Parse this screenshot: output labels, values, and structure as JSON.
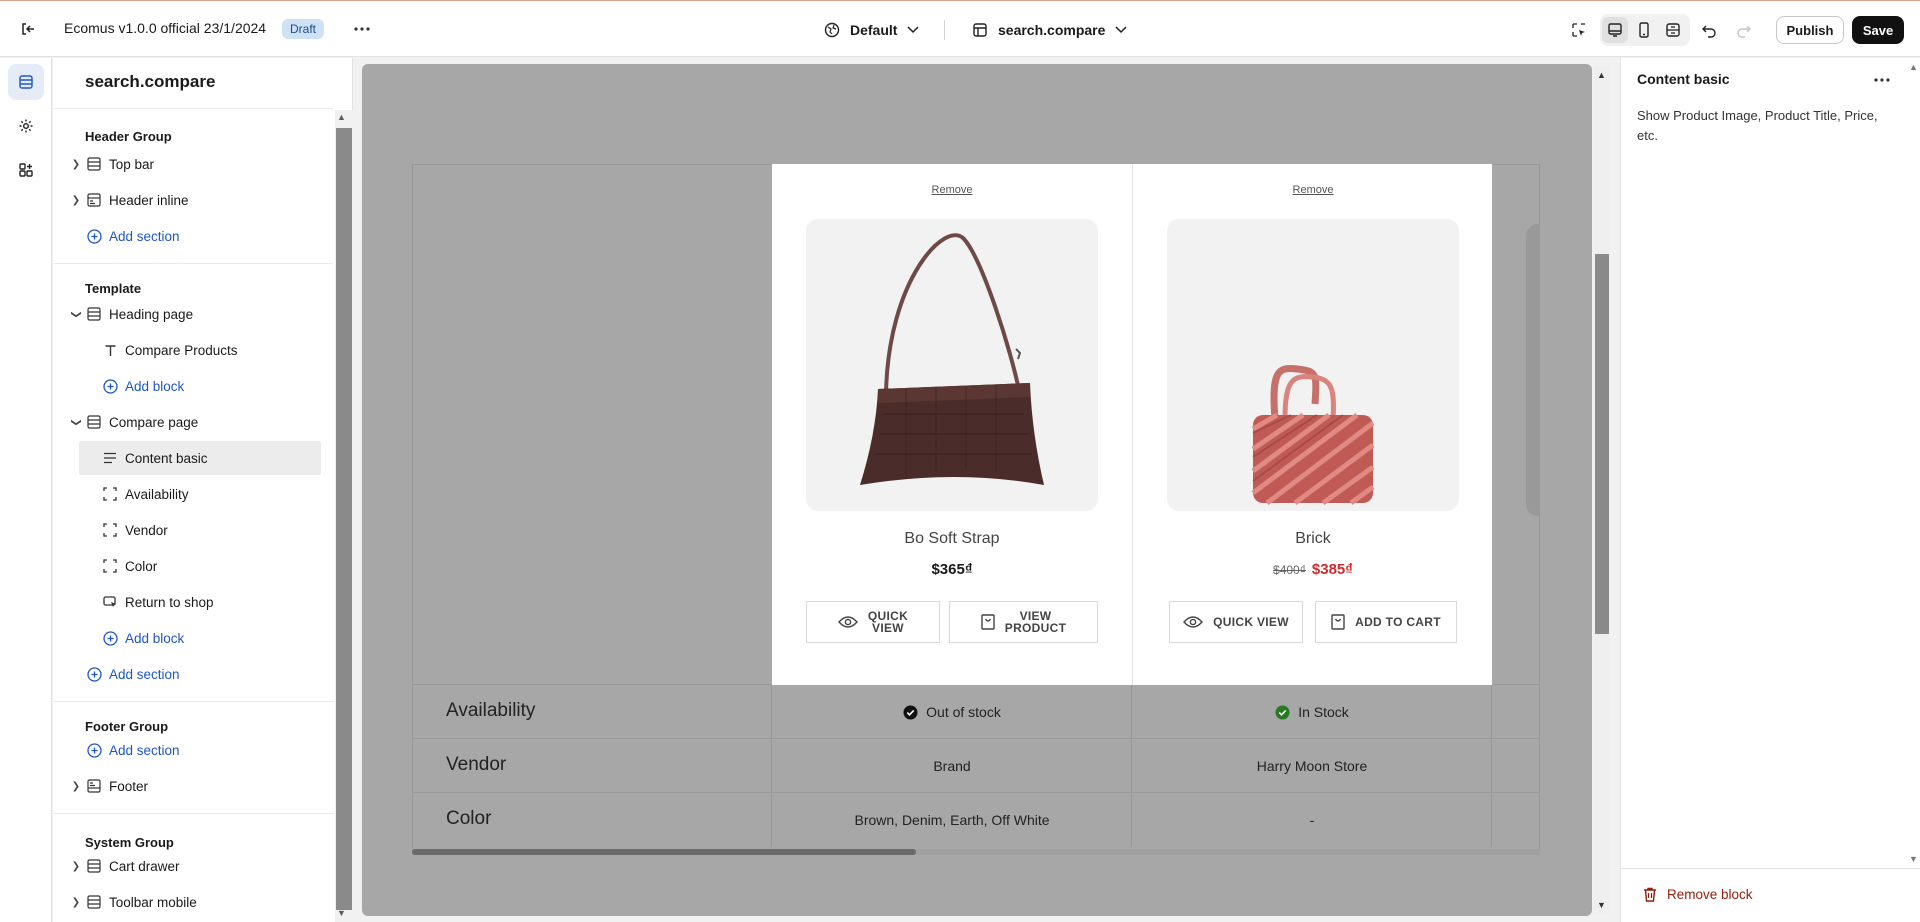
{
  "topbar": {
    "title": "Ecomus v1.0.0 official 23/1/2024",
    "badge": "Draft",
    "theme_label": "Default",
    "page_label": "search.compare",
    "publish_label": "Publish",
    "save_label": "Save"
  },
  "sidebar": {
    "title": "search.compare",
    "header_group": {
      "heading": "Header Group",
      "items": [
        "Top bar",
        "Header inline"
      ],
      "add_section": "Add section"
    },
    "template": {
      "heading": "Template",
      "heading_page": "Heading page",
      "compare_products": "Compare Products",
      "add_block_1": "Add block",
      "compare_page": "Compare page",
      "blocks": [
        "Content basic",
        "Availability",
        "Vendor",
        "Color",
        "Return to shop"
      ],
      "add_block_2": "Add block",
      "add_section": "Add section"
    },
    "footer_group": {
      "heading": "Footer Group",
      "add_section": "Add section",
      "footer": "Footer"
    },
    "system_group": {
      "heading": "System Group",
      "items": [
        "Cart drawer",
        "Toolbar mobile"
      ]
    }
  },
  "compare": {
    "products": [
      {
        "remove": "Remove",
        "name": "Bo Soft Strap",
        "price": "$365₫",
        "btn1_a": "QUICK",
        "btn1_b": "VIEW",
        "btn2_a": "VIEW",
        "btn2_b": "PRODUCT",
        "image": "bag-brown-icon"
      },
      {
        "remove": "Remove",
        "name": "Brick",
        "old_price": "$400₫",
        "price": "$385₫",
        "btn1": "QUICK VIEW",
        "btn2": "ADD TO CART",
        "image": "bag-pink-icon"
      }
    ],
    "rows": [
      {
        "label": "Availability",
        "values": [
          "Out of stock",
          "In Stock"
        ]
      },
      {
        "label": "Vendor",
        "values": [
          "Brand",
          "Harry Moon Store"
        ]
      },
      {
        "label": "Color",
        "values": [
          "Brown, Denim, Earth, Off White",
          "-"
        ]
      }
    ],
    "colors": {
      "in_stock": "#287a22",
      "sale": "#d22b2b"
    }
  },
  "right_panel": {
    "title": "Content basic",
    "description": "Show Product Image, Product Title, Price, etc.",
    "remove_block": "Remove block"
  }
}
